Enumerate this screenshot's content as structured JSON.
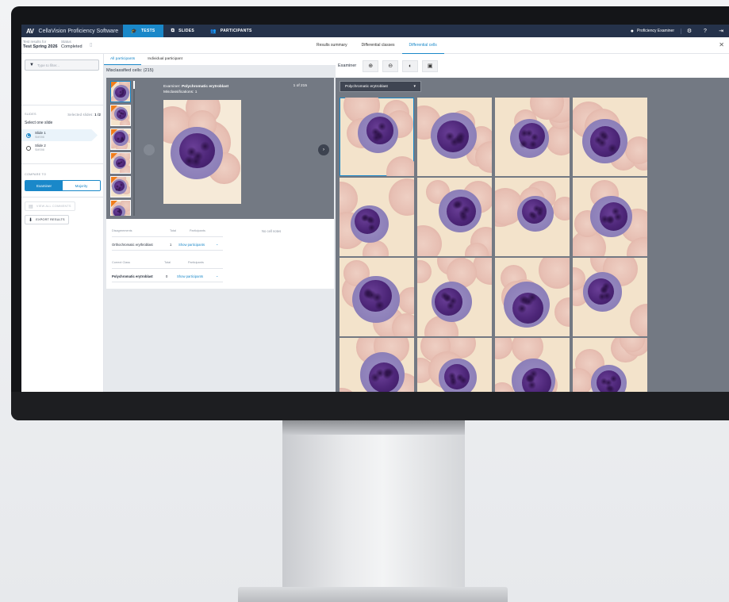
{
  "app": {
    "logo": "AV",
    "name": "CellaVision Proficiency Software",
    "nav": [
      {
        "label": "TESTS",
        "icon": "graduation-cap-icon",
        "glyph": "🎓"
      },
      {
        "label": "SLIDES",
        "icon": "slides-icon",
        "glyph": "⧉"
      },
      {
        "label": "PARTICIPANTS",
        "icon": "people-icon",
        "glyph": "👥"
      }
    ],
    "user": "Proficiency Examiner",
    "icons": {
      "settings": "⚙",
      "help": "?",
      "logout": "⇥",
      "close": "✕",
      "filter": "▼",
      "comments": "▤",
      "export": "⬇"
    }
  },
  "subheader": {
    "test_label": "Test results for",
    "test_name": "Test Spring 2026",
    "status_label": "Status",
    "status_value": "Completed",
    "tabs": [
      "Results summary",
      "Differential classes",
      "Differential cells"
    ],
    "active_tab": 2
  },
  "sidebar": {
    "filter_placeholder": "Type to filter...",
    "slides_label": "SLIDES",
    "selected_prefix": "Selected slides:",
    "selected_value": "1 /2",
    "select_one": "Select one slide",
    "slides": [
      {
        "name": "Slide 1",
        "sub": "SMS98",
        "selected": true
      },
      {
        "name": "Slide 2",
        "sub": "SMS98",
        "selected": false
      }
    ],
    "compare_label": "COMPARE TO",
    "compare_options": [
      "Examiner",
      "Majority"
    ],
    "view_comments": "VIEW ALL COMMENTS",
    "export_results": "EXPORT RESULTS"
  },
  "middle": {
    "tabs": [
      "All participants",
      "Individual participant"
    ],
    "misclassified": "Misclassified cells: (215)",
    "examiner_prefix": "Examiner:",
    "examiner_class": "Polychromatic erytroblast",
    "misclassifications": "Misclassifications: 1",
    "counter": "1 of 215",
    "disagreements": {
      "headers": [
        "Disagreements",
        "Total",
        "Participants"
      ],
      "row": {
        "name": "Orthochromatic erythroblast",
        "total": "1",
        "link": "Show participants"
      }
    },
    "correct": {
      "headers": [
        "Correct Class",
        "Total",
        "Participants"
      ],
      "row": {
        "name": "Polychromatic erytroblast",
        "total": "0",
        "link": "Show participants"
      }
    },
    "no_comments": "No cell notes"
  },
  "right": {
    "examiner": "Examiner",
    "tools": [
      {
        "name": "zoom-in-icon",
        "glyph": "🔍"
      },
      {
        "name": "zoom-out-icon",
        "glyph": "🔍"
      },
      {
        "name": "contrast-icon",
        "glyph": "◐"
      },
      {
        "name": "image-toggle-icon",
        "glyph": "▣"
      }
    ],
    "class_dropdown": "Polychromatic erytroblast"
  }
}
